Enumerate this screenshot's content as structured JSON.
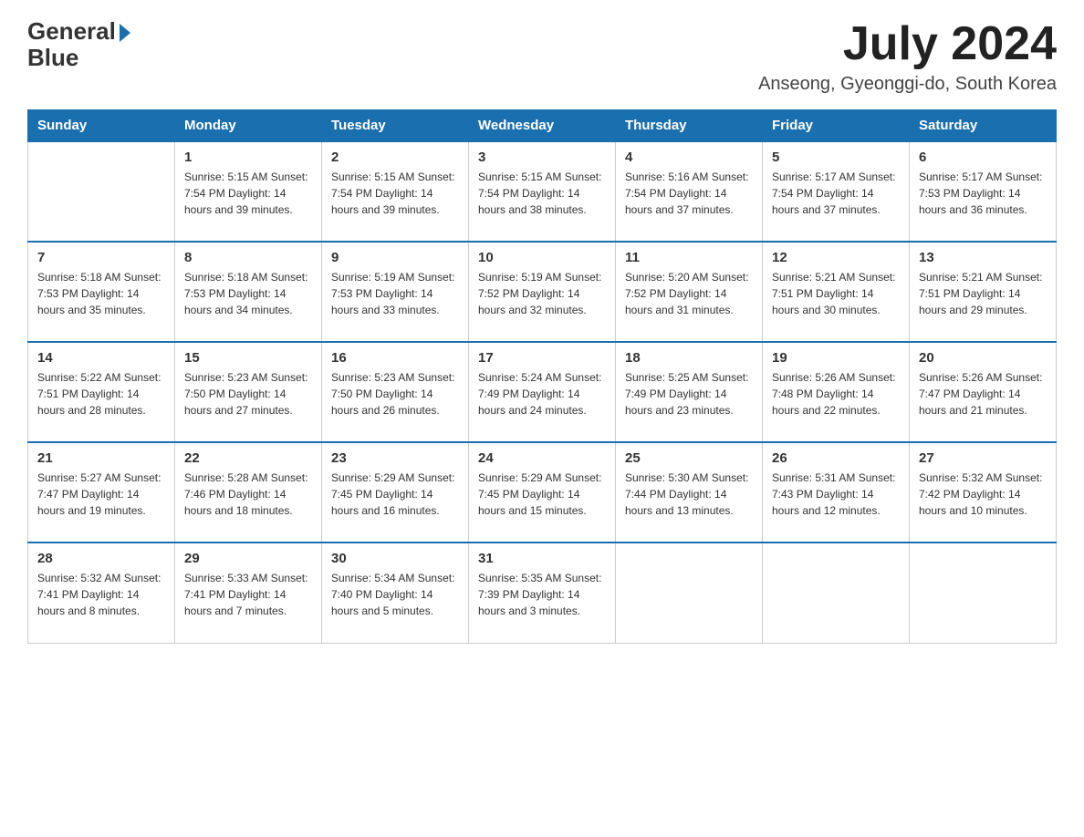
{
  "header": {
    "logo_text_general": "General",
    "logo_text_blue": "Blue",
    "month_title": "July 2024",
    "location": "Anseong, Gyeonggi-do, South Korea"
  },
  "columns": [
    "Sunday",
    "Monday",
    "Tuesday",
    "Wednesday",
    "Thursday",
    "Friday",
    "Saturday"
  ],
  "weeks": [
    [
      {
        "day": "",
        "info": ""
      },
      {
        "day": "1",
        "info": "Sunrise: 5:15 AM\nSunset: 7:54 PM\nDaylight: 14 hours\nand 39 minutes."
      },
      {
        "day": "2",
        "info": "Sunrise: 5:15 AM\nSunset: 7:54 PM\nDaylight: 14 hours\nand 39 minutes."
      },
      {
        "day": "3",
        "info": "Sunrise: 5:15 AM\nSunset: 7:54 PM\nDaylight: 14 hours\nand 38 minutes."
      },
      {
        "day": "4",
        "info": "Sunrise: 5:16 AM\nSunset: 7:54 PM\nDaylight: 14 hours\nand 37 minutes."
      },
      {
        "day": "5",
        "info": "Sunrise: 5:17 AM\nSunset: 7:54 PM\nDaylight: 14 hours\nand 37 minutes."
      },
      {
        "day": "6",
        "info": "Sunrise: 5:17 AM\nSunset: 7:53 PM\nDaylight: 14 hours\nand 36 minutes."
      }
    ],
    [
      {
        "day": "7",
        "info": "Sunrise: 5:18 AM\nSunset: 7:53 PM\nDaylight: 14 hours\nand 35 minutes."
      },
      {
        "day": "8",
        "info": "Sunrise: 5:18 AM\nSunset: 7:53 PM\nDaylight: 14 hours\nand 34 minutes."
      },
      {
        "day": "9",
        "info": "Sunrise: 5:19 AM\nSunset: 7:53 PM\nDaylight: 14 hours\nand 33 minutes."
      },
      {
        "day": "10",
        "info": "Sunrise: 5:19 AM\nSunset: 7:52 PM\nDaylight: 14 hours\nand 32 minutes."
      },
      {
        "day": "11",
        "info": "Sunrise: 5:20 AM\nSunset: 7:52 PM\nDaylight: 14 hours\nand 31 minutes."
      },
      {
        "day": "12",
        "info": "Sunrise: 5:21 AM\nSunset: 7:51 PM\nDaylight: 14 hours\nand 30 minutes."
      },
      {
        "day": "13",
        "info": "Sunrise: 5:21 AM\nSunset: 7:51 PM\nDaylight: 14 hours\nand 29 minutes."
      }
    ],
    [
      {
        "day": "14",
        "info": "Sunrise: 5:22 AM\nSunset: 7:51 PM\nDaylight: 14 hours\nand 28 minutes."
      },
      {
        "day": "15",
        "info": "Sunrise: 5:23 AM\nSunset: 7:50 PM\nDaylight: 14 hours\nand 27 minutes."
      },
      {
        "day": "16",
        "info": "Sunrise: 5:23 AM\nSunset: 7:50 PM\nDaylight: 14 hours\nand 26 minutes."
      },
      {
        "day": "17",
        "info": "Sunrise: 5:24 AM\nSunset: 7:49 PM\nDaylight: 14 hours\nand 24 minutes."
      },
      {
        "day": "18",
        "info": "Sunrise: 5:25 AM\nSunset: 7:49 PM\nDaylight: 14 hours\nand 23 minutes."
      },
      {
        "day": "19",
        "info": "Sunrise: 5:26 AM\nSunset: 7:48 PM\nDaylight: 14 hours\nand 22 minutes."
      },
      {
        "day": "20",
        "info": "Sunrise: 5:26 AM\nSunset: 7:47 PM\nDaylight: 14 hours\nand 21 minutes."
      }
    ],
    [
      {
        "day": "21",
        "info": "Sunrise: 5:27 AM\nSunset: 7:47 PM\nDaylight: 14 hours\nand 19 minutes."
      },
      {
        "day": "22",
        "info": "Sunrise: 5:28 AM\nSunset: 7:46 PM\nDaylight: 14 hours\nand 18 minutes."
      },
      {
        "day": "23",
        "info": "Sunrise: 5:29 AM\nSunset: 7:45 PM\nDaylight: 14 hours\nand 16 minutes."
      },
      {
        "day": "24",
        "info": "Sunrise: 5:29 AM\nSunset: 7:45 PM\nDaylight: 14 hours\nand 15 minutes."
      },
      {
        "day": "25",
        "info": "Sunrise: 5:30 AM\nSunset: 7:44 PM\nDaylight: 14 hours\nand 13 minutes."
      },
      {
        "day": "26",
        "info": "Sunrise: 5:31 AM\nSunset: 7:43 PM\nDaylight: 14 hours\nand 12 minutes."
      },
      {
        "day": "27",
        "info": "Sunrise: 5:32 AM\nSunset: 7:42 PM\nDaylight: 14 hours\nand 10 minutes."
      }
    ],
    [
      {
        "day": "28",
        "info": "Sunrise: 5:32 AM\nSunset: 7:41 PM\nDaylight: 14 hours\nand 8 minutes."
      },
      {
        "day": "29",
        "info": "Sunrise: 5:33 AM\nSunset: 7:41 PM\nDaylight: 14 hours\nand 7 minutes."
      },
      {
        "day": "30",
        "info": "Sunrise: 5:34 AM\nSunset: 7:40 PM\nDaylight: 14 hours\nand 5 minutes."
      },
      {
        "day": "31",
        "info": "Sunrise: 5:35 AM\nSunset: 7:39 PM\nDaylight: 14 hours\nand 3 minutes."
      },
      {
        "day": "",
        "info": ""
      },
      {
        "day": "",
        "info": ""
      },
      {
        "day": "",
        "info": ""
      }
    ]
  ]
}
